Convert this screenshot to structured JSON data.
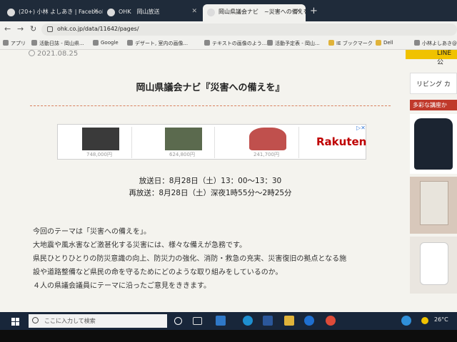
{
  "browser": {
    "tabs": [
      {
        "label": "(20+) 小林 よしあき | Facebook",
        "active": false
      },
      {
        "label": "OHK　岡山放送",
        "active": false
      },
      {
        "label": "岡山県議会ナビ　~災害への備えを",
        "active": true
      }
    ],
    "url": "ohk.co.jp/data/11642/pages/",
    "bookmarks": [
      "アプリ",
      "活動日誌 - 岡山県...",
      "Google",
      "デザート, 室内の画像...",
      "テキストの画像のよう...",
      "活動予定表 - 岡山...",
      "IE ブックマーク",
      "Dell",
      "小林よしあき@"
    ]
  },
  "article": {
    "date": "2021.08.25",
    "title": "岡山県議会ナビ『災害への備えを』",
    "broadcast": "放送日：8月28日（土）13：00～13：30",
    "rebroadcast": "再放送：8月28日（土）深夜1時55分～2時25分",
    "paragraphs": [
      "今回のテーマは「災害への備えを」。",
      "大地震や風水害など激甚化する災害には、様々な備えが急務です。",
      "県民ひとりひとりの防災意識の向上、防災力の強化、消防・救急の充実、災害復旧の拠点となる施",
      "設や道路整備など県民の命を守るためにどのような取り組みをしているのか。",
      "４人の県議会議員にテーマに沿ったご意見をききます。"
    ]
  },
  "ad": {
    "prices": [
      "748,000円",
      "624,800円",
      "241,700円"
    ],
    "brand": "Rakuten",
    "colors": [
      "#3a3a3a",
      "#5b6a4e",
      "#c0504d"
    ]
  },
  "sidebar": {
    "line_label": "LINE公",
    "living_label": "リビング カ",
    "red_label": "多彩な講座か"
  },
  "taskbar": {
    "search_placeholder": "ここに入力して検索",
    "temperature": "26°C"
  }
}
